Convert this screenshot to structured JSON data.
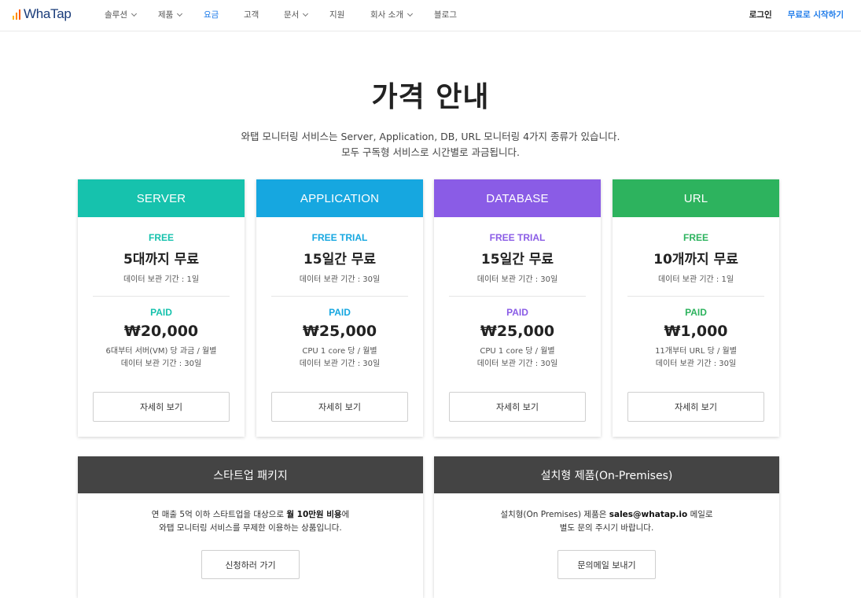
{
  "nav": {
    "logo_text": "WhaTap",
    "items": [
      {
        "label": "솔루션",
        "has_dropdown": true
      },
      {
        "label": "제품",
        "has_dropdown": true
      },
      {
        "label": "요금",
        "active": true
      },
      {
        "label": "고객"
      },
      {
        "label": "문서",
        "has_dropdown": true
      },
      {
        "label": "지원"
      },
      {
        "label": "회사 소개",
        "has_dropdown": true
      },
      {
        "label": "블로그"
      }
    ],
    "login": "로그인",
    "start_free": "무료로 시작하기"
  },
  "hero": {
    "title": "가격 안내",
    "desc_line1": "와탭 모니터링 서비스는 Server, Application, DB, URL 모니터링 4가지 종류가 있습니다.",
    "desc_line2": "모두 구독형 서비스로 시간별로 과금됩니다."
  },
  "cards": [
    {
      "name": "SERVER",
      "color": "#16c2ad",
      "free_label": "FREE",
      "free_main": "5대까지 무료",
      "free_sub": "데이터 보관 기간 : 1일",
      "paid_label": "PAID",
      "price": "₩20,000",
      "paid_sub1": "6대부터 서버(VM) 당 과금 / 월별",
      "paid_sub2": "데이터 보관 기간 : 30일",
      "button": "자세히 보기"
    },
    {
      "name": "APPLICATION",
      "color": "#16a7e0",
      "free_label": "FREE TRIAL",
      "free_main": "15일간 무료",
      "free_sub": "데이터 보관 기간 : 30일",
      "paid_label": "PAID",
      "price": "₩25,000",
      "paid_sub1": "CPU 1 core 당 / 월별",
      "paid_sub2": "데이터 보관 기간 : 30일",
      "button": "자세히 보기"
    },
    {
      "name": "DATABASE",
      "color": "#8a5ce6",
      "free_label": "FREE TRIAL",
      "free_main": "15일간 무료",
      "free_sub": "데이터 보관 기간 : 30일",
      "paid_label": "PAID",
      "price": "₩25,000",
      "paid_sub1": "CPU 1 core 당 / 월별",
      "paid_sub2": "데이터 보관 기간 : 30일",
      "button": "자세히 보기"
    },
    {
      "name": "URL",
      "color": "#2db35e",
      "free_label": "FREE",
      "free_main": "10개까지 무료",
      "free_sub": "데이터 보관 기간 : 1일",
      "paid_label": "PAID",
      "price": "₩1,000",
      "paid_sub1": "11개부터 URL 당 / 월별",
      "paid_sub2": "데이터 보관 기간 : 30일",
      "button": "자세히 보기"
    }
  ],
  "startup": {
    "title": "스타트업 패키지",
    "line1_pre": "연 매출 5억 이하 스타트업을 대상으로 ",
    "line1_bold": "월 10만원 비용",
    "line1_post": "에",
    "line2": "와탭 모니터링 서비스를 무제한 이용하는 상품입니다.",
    "button": "신청하러 가기"
  },
  "onprem": {
    "title": "설치형 제품(On-Premises)",
    "line1_pre": "설치형(On Premises) 제품은 ",
    "line1_bold": "sales@whatap.io",
    "line1_post": " 메일로",
    "line2": "별도 문의 주시기 바랍니다.",
    "button": "문의메일 보내기"
  }
}
